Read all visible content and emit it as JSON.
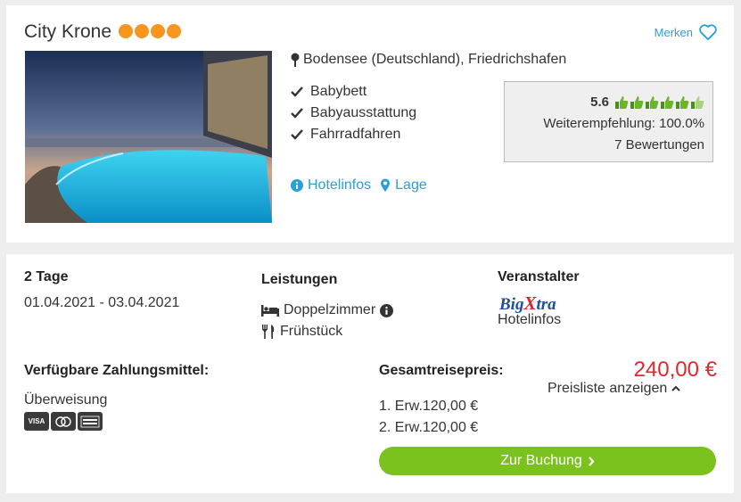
{
  "hotel": {
    "name": "City Krone",
    "stars": 4,
    "merken_label": "Merken",
    "location": "Bodensee (Deutschland), Friedrichshafen",
    "features": [
      "Babybett",
      "Babyausstattung",
      "Fahrradfahren"
    ],
    "links": {
      "hotelinfos": "Hotelinfos",
      "lage": "Lage"
    },
    "rating": {
      "score": "5.6",
      "thumbs": 6,
      "recommendation": "Weiterempfehlung: 100.0%",
      "reviews": "7 Bewertungen"
    }
  },
  "offer": {
    "duration": "2 Tage",
    "dates": "01.04.2021 - 03.04.2021",
    "services_title": "Leistungen",
    "room": "Doppelzimmer",
    "board": "Frühstück",
    "operator_title": "Veranstalter",
    "operator_logo": {
      "part1": "Big",
      "part2": "X",
      "part3": "tra"
    },
    "operator_link": "Hotelinfos",
    "payment_title": "Verfügbare Zahlungsmittel:",
    "payment_method": "Überweisung",
    "payment_icons": [
      "VISA",
      "Mastercard",
      "American Express"
    ],
    "total_title": "Gesamtreisepreis:",
    "total_price": "240,00 €",
    "pricelist_label": "Preisliste anzeigen",
    "price_rows": [
      "1. Erw.120,00 €",
      "2. Erw.120,00 €"
    ],
    "booking_button": "Zur Buchung",
    "colors": {
      "accent": "#2b9fd6",
      "price": "#e3262e",
      "button": "#7cc21e",
      "stars": "#f5961e"
    }
  }
}
